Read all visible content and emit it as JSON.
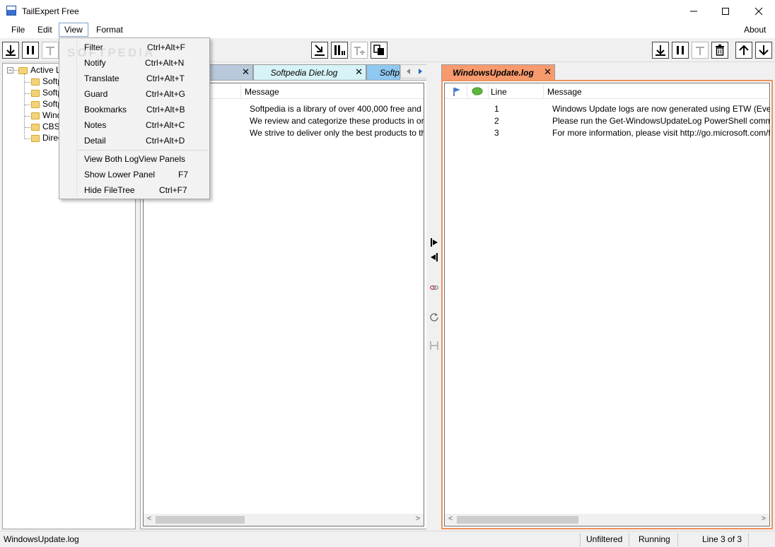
{
  "window": {
    "title": "TailExpert Free"
  },
  "menubar": {
    "file": "File",
    "edit": "Edit",
    "view": "View",
    "format": "Format",
    "about": "About"
  },
  "view_menu": {
    "items": [
      {
        "label": "Filter",
        "shortcut": "Ctrl+Alt+F"
      },
      {
        "label": "Notify",
        "shortcut": "Ctrl+Alt+N"
      },
      {
        "label": "Translate",
        "shortcut": "Ctrl+Alt+T"
      },
      {
        "label": "Guard",
        "shortcut": "Ctrl+Alt+G"
      },
      {
        "label": "Bookmarks",
        "shortcut": "Ctrl+Alt+B"
      },
      {
        "label": "Notes",
        "shortcut": "Ctrl+Alt+C"
      },
      {
        "label": "Detail",
        "shortcut": "Ctrl+Alt+D"
      }
    ],
    "items2": [
      {
        "label": "View Both LogView Panels",
        "shortcut": ""
      },
      {
        "label": "Show Lower Panel",
        "shortcut": "F7"
      },
      {
        "label": "Hide FileTree",
        "shortcut": "Ctrl+F7"
      }
    ]
  },
  "watermark": "SOFTPEDIA",
  "tree": {
    "root": "Active Lo",
    "children": [
      "Softp",
      "Softp",
      "Softp",
      "Windo",
      "CBS",
      "Direc"
    ]
  },
  "left_panel": {
    "tabs": [
      {
        "label": "g",
        "color": "#b9c9dc"
      },
      {
        "label": "Softpedia Diet.log",
        "color": "#d7f3f7"
      },
      {
        "label": "Softp",
        "color": "#8fc8f0"
      }
    ],
    "header": {
      "message": "Message"
    },
    "rows": [
      "Softpedia is a library of over 400,000 free and free-to",
      "We review and categorize these products in order to",
      "We strive to deliver only the best products to the visi"
    ]
  },
  "right_panel": {
    "tab": {
      "label": "WindowsUpdate.log",
      "color": "#f79a6e"
    },
    "header": {
      "line": "Line",
      "message": "Message"
    },
    "rows": [
      {
        "line": "1",
        "message": "Windows Update logs are now generated using ETW (Event Trac"
      },
      {
        "line": "2",
        "message": "Please run the Get-WindowsUpdateLog PowerShell command to"
      },
      {
        "line": "3",
        "message": "For more information, please visit http://go.microsoft.com/fwlink/?"
      }
    ],
    "border_color": "#f0905c"
  },
  "statusbar": {
    "file": "WindowsUpdate.log",
    "filter": "Unfiltered",
    "state": "Running",
    "position": "Line 3 of 3"
  }
}
